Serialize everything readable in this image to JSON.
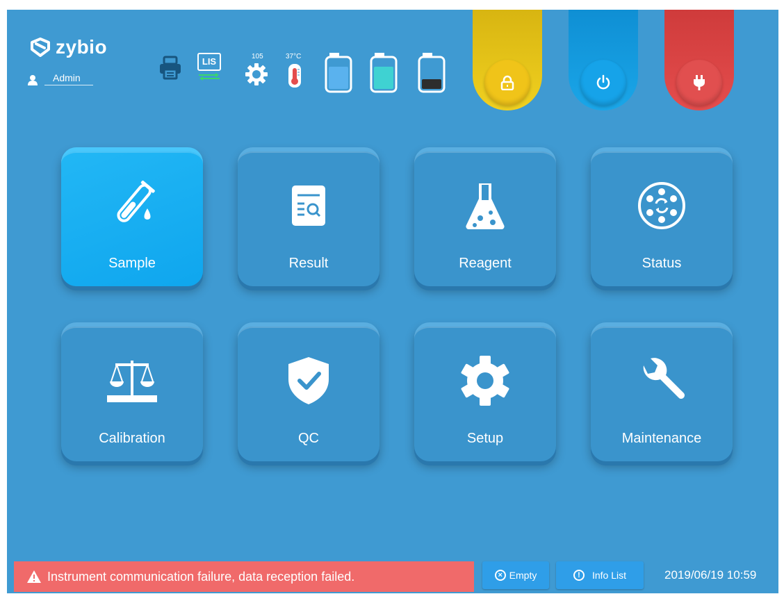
{
  "header": {
    "brand": "zybio",
    "user": "Admin",
    "lis_label": "LIS",
    "gear_value": "105",
    "temperature": "37°C"
  },
  "tiles": [
    {
      "label": "Sample",
      "icon": "test-tube-icon",
      "active": true
    },
    {
      "label": "Result",
      "icon": "report-search-icon"
    },
    {
      "label": "Reagent",
      "icon": "flask-icon"
    },
    {
      "label": "Status",
      "icon": "rotor-status-icon"
    },
    {
      "label": "Calibration",
      "icon": "balance-scale-icon"
    },
    {
      "label": "QC",
      "icon": "shield-check-icon"
    },
    {
      "label": "Setup",
      "icon": "gear-icon"
    },
    {
      "label": "Maintenance",
      "icon": "wrench-icon"
    }
  ],
  "footer": {
    "alert": "Instrument communication failure, data reception failed.",
    "empty_label": "Empty",
    "info_label": "Info List",
    "datetime": "2019/06/19 10:59"
  },
  "colors": {
    "background": "#3f9ad2",
    "active_tile": "#14a9f0",
    "lock": "#e6c619",
    "power": "#1aa6e8",
    "plug": "#e44d4d",
    "alert": "#f06a6a"
  }
}
